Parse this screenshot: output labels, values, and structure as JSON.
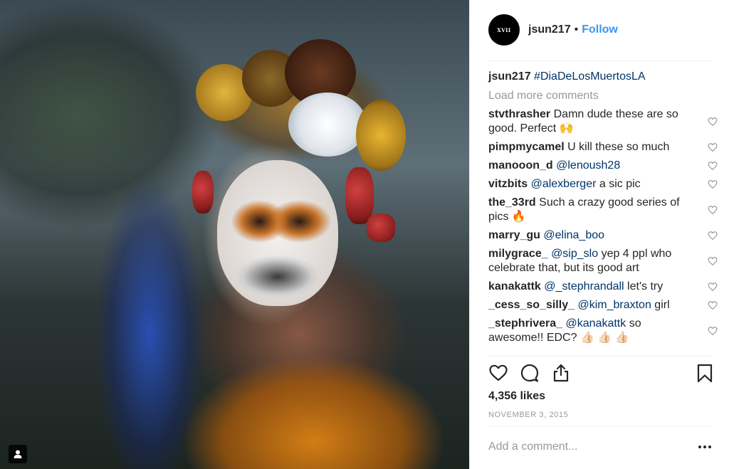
{
  "post": {
    "avatar_text": "XVII",
    "username": "jsun217",
    "separator": "•",
    "follow_label": "Follow"
  },
  "caption": {
    "username": "jsun217",
    "text": "#DiaDeLosMuertosLA"
  },
  "load_more_label": "Load more comments",
  "comments": [
    {
      "user": "stvthrasher",
      "mention": "",
      "text": "Damn dude these are so good. Perfect 🙌"
    },
    {
      "user": "pimpmycamel",
      "mention": "",
      "text": "U kill these so much"
    },
    {
      "user": "manooon_d",
      "mention": "@lenoush28",
      "text": ""
    },
    {
      "user": "vitzbits",
      "mention": "@alexberger",
      "text": "a sic pic"
    },
    {
      "user": "the_33rd",
      "mention": "",
      "text": "Such a crazy good series of pics 🔥"
    },
    {
      "user": "marry_gu",
      "mention": "@elina_boo",
      "text": ""
    },
    {
      "user": "milygrace_",
      "mention": "@sip_slo",
      "text": "yep 4 ppl who celebrate that, but its good art"
    },
    {
      "user": "kanakattk",
      "mention": "@_stephrandall",
      "text": "let's try"
    },
    {
      "user": "_cess_so_silly_",
      "mention": "@kim_braxton",
      "text": "girl"
    },
    {
      "user": "_stephrivera_",
      "mention": "@kanakattk",
      "text": "so awesome!! EDC? 👍🏻 👍🏻 👍🏻"
    }
  ],
  "likes": "4,356 likes",
  "date": "NOVEMBER 3, 2015",
  "add_comment_placeholder": "Add a comment...",
  "icons": {
    "like": "heart-icon",
    "comment": "speech-bubble-icon",
    "share": "share-icon",
    "save": "bookmark-icon",
    "more": "more-options-icon",
    "tagged_user": "user-tag-icon"
  },
  "colors": {
    "link": "#3897f0",
    "mention": "#003569",
    "muted": "#999999",
    "text": "#262626"
  }
}
